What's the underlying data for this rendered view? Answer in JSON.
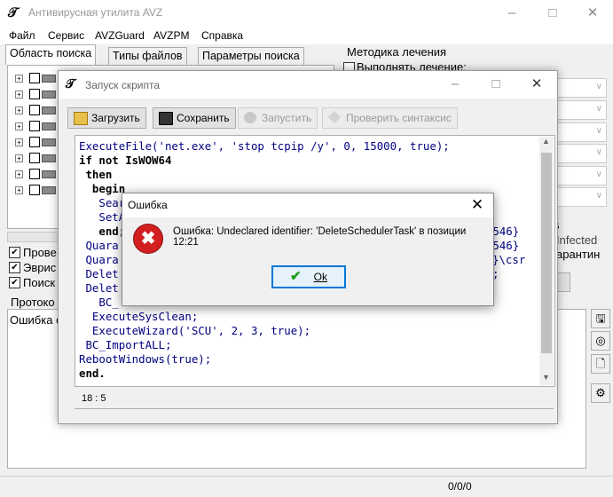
{
  "app": {
    "title": "Антивирусная утилита AVZ"
  },
  "menu": [
    "Файл",
    "Сервис",
    "AVZGuard",
    "AVZPM",
    "Справка"
  ],
  "tabs": [
    "Область поиска",
    "Типы файлов",
    "Параметры поиска"
  ],
  "right_panel": {
    "group_label": "Методика лечения",
    "perform_treatment": "Выполнять лечение:",
    "partial_text_1": "s",
    "partial_text_2": "Infected",
    "partial_text_3": "арантин"
  },
  "checkboxes": [
    "Прове",
    "Эврис",
    "Поиск"
  ],
  "bottom": {
    "tab_label": "Протоко",
    "log_text": "Ошибка с",
    "status": "0/0/0"
  },
  "script_window": {
    "title": "Запуск скрипта",
    "buttons": {
      "load": "Загрузить",
      "save": "Сохранить",
      "run": "Запустить",
      "check": "Проверить синтаксис"
    },
    "code_lines": [
      "ExecuteFile('net.exe', 'stop tcpip /y', 0, 15000, true);",
      "if not IsWOW64",
      " then",
      "  begin",
      "   Sear",
      "   SetA",
      "   end;",
      " Quara",
      " Quara",
      " Delet",
      " Delet",
      "   BC_",
      "  ExecuteSysClean;",
      "  ExecuteWizard('SCU', 2, 3, true);",
      " BC_ImportALL;",
      "RebootWindows(true);",
      "end."
    ],
    "code_right_fragments": [
      "294546}",
      "294546}",
      "}\\csr",
      ";"
    ],
    "cursor_pos": "18 : 5"
  },
  "error_dialog": {
    "title": "Ошибка",
    "message": "Ошибка: Undeclared identifier: 'DeleteSchedulerTask' в позиции 12:21",
    "ok_label": "Ok"
  }
}
